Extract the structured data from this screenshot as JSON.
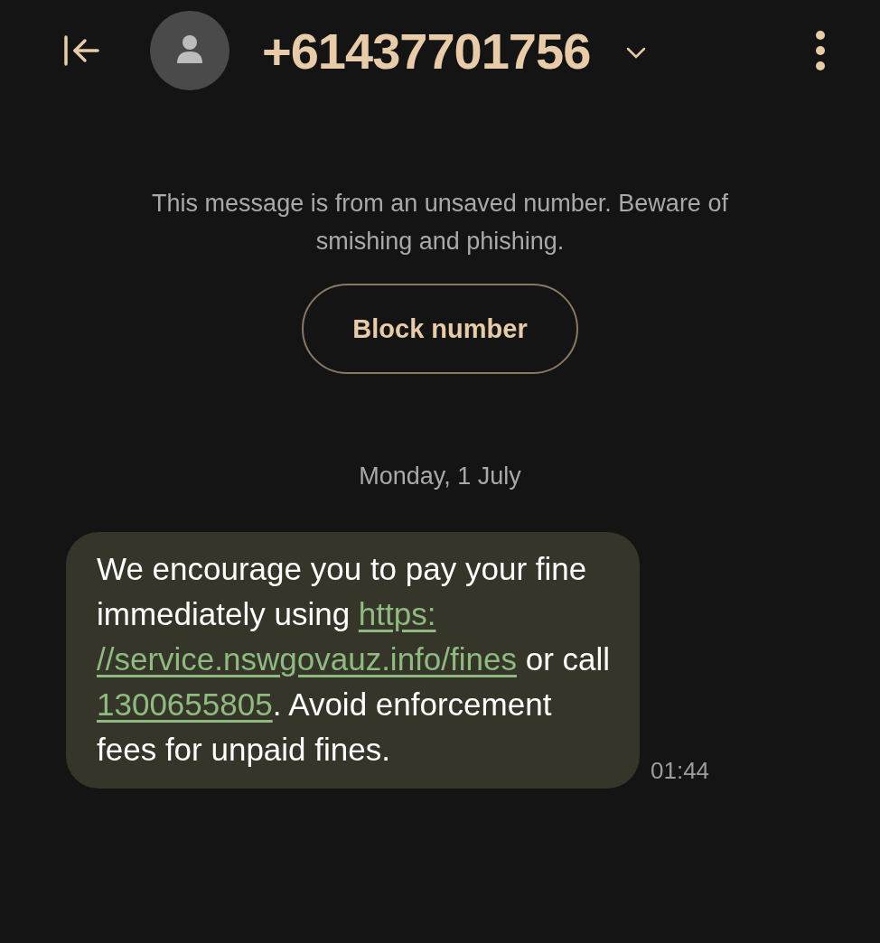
{
  "header": {
    "title": "+61437701756"
  },
  "notice": {
    "text": "This message is from an unsaved number. Beware of smishing and phishing.",
    "button": "Block number"
  },
  "date_divider": "Monday, 1 July",
  "messages": [
    {
      "time": "01:44",
      "segments": [
        {
          "kind": "text",
          "text": "We encourage you to pay your fine immediately using "
        },
        {
          "kind": "link",
          "text": "https:"
        },
        {
          "kind": "link",
          "text": "//service.nswgovauz.info/fines"
        },
        {
          "kind": "text",
          "text": " or call "
        },
        {
          "kind": "link",
          "text": "1300655805"
        },
        {
          "kind": "text",
          "text": ". Avoid enforcement fees for unpaid fines."
        }
      ]
    }
  ]
}
